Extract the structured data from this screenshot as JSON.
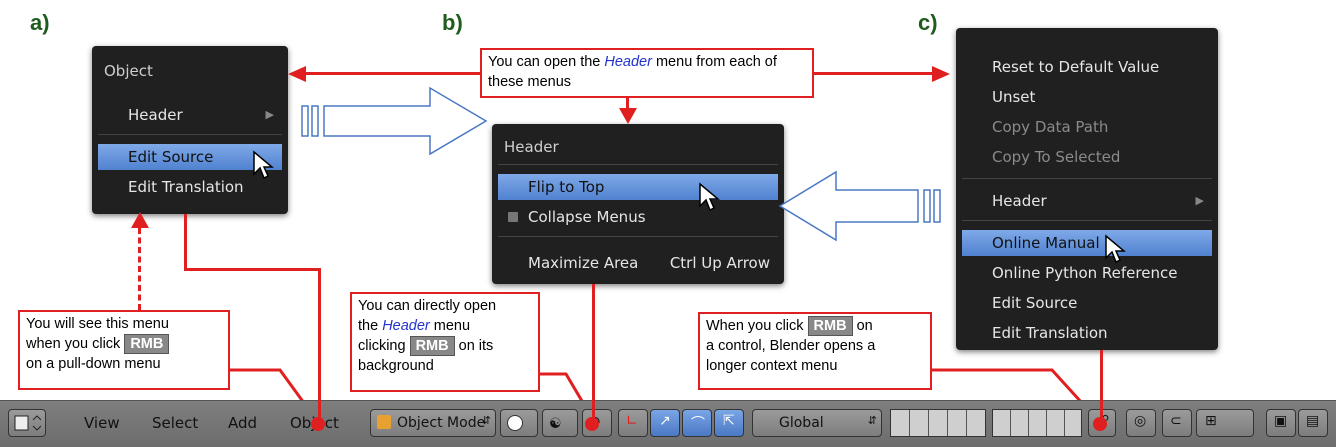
{
  "labels": {
    "a": "a)",
    "b": "b)",
    "c": "c)"
  },
  "menu_a": {
    "title": "Object",
    "items": [
      {
        "label": "Header",
        "submenu": true
      },
      {
        "label": "Edit Source",
        "highlighted": true
      },
      {
        "label": "Edit Translation"
      }
    ]
  },
  "menu_b": {
    "title": "Header",
    "items": [
      {
        "label": "Flip to Top",
        "highlighted": true
      },
      {
        "label": "Collapse Menus",
        "checkbox": true
      },
      {
        "label": "Maximize Area",
        "shortcut": "Ctrl Up Arrow"
      }
    ]
  },
  "menu_c": {
    "items": [
      {
        "label": "Reset to Default Value"
      },
      {
        "label": "Unset"
      },
      {
        "label": "Copy Data Path",
        "disabled": true
      },
      {
        "label": "Copy To Selected",
        "disabled": true
      },
      {
        "label": "Header",
        "submenu": true
      },
      {
        "label": "Online Manual",
        "highlighted": true
      },
      {
        "label": "Online Python Reference"
      },
      {
        "label": "Edit Source"
      },
      {
        "label": "Edit Translation"
      }
    ]
  },
  "callouts": {
    "top": {
      "pre": "You can open the ",
      "em": "Header",
      "post": " menu from each of these menus"
    },
    "left": {
      "line1": "You will see this menu",
      "line2_pre": "when you click ",
      "rmb": "RMB",
      "line3": "on a pull-down menu"
    },
    "middle": {
      "line1": "You can directly open",
      "line2_pre": "the ",
      "em": "Header",
      "line2_post": " menu",
      "line3_pre": "clicking ",
      "rmb": "RMB",
      "line3_post": " on its",
      "line4": "background"
    },
    "right": {
      "line1_pre": "When you click ",
      "rmb": "RMB",
      "line1_post": " on",
      "line2": "a control, Blender opens a",
      "line3": "longer context menu"
    }
  },
  "toolbar": {
    "menus": [
      "View",
      "Select",
      "Add",
      "Object"
    ],
    "mode": "Object Mode",
    "orientation": "Global"
  },
  "colors": {
    "callout_border": "#e02020",
    "highlight": "#5082d0",
    "menu_bg": "#202020"
  }
}
